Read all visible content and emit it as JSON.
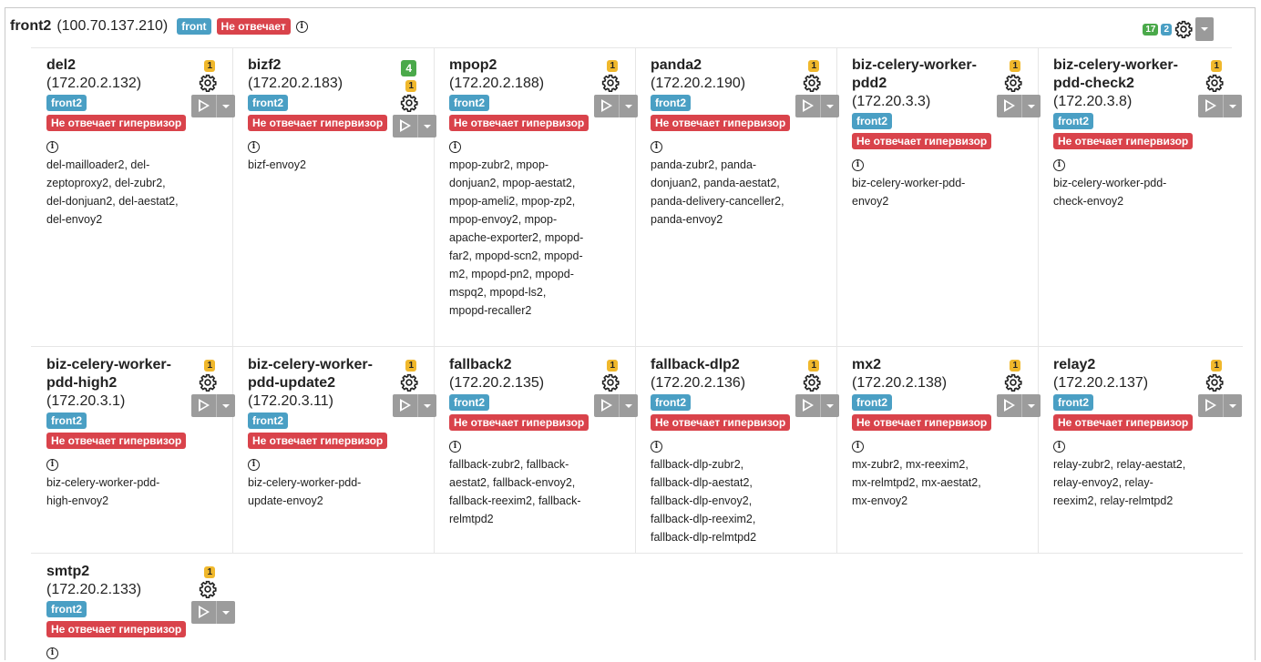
{
  "host": {
    "name": "front2",
    "ip": "(100.70.137.210)",
    "group_label": "front",
    "status_label": "Не отвечает",
    "count_green": "17",
    "count_blue": "2"
  },
  "vms": [
    {
      "name": "del2",
      "ip": "(172.20.2.132)",
      "tag": "front2",
      "status": "Не отвечает гипервизор",
      "badges": [
        {
          "type": "warning",
          "text": "1"
        }
      ],
      "services": "del-mailloader2, del-zeptoproxy2, del-zubr2, del-donjuan2, del-aestat2, del-envoy2"
    },
    {
      "name": "bizf2",
      "ip": "(172.20.2.183)",
      "tag": "front2",
      "status": "Не отвечает гипервизор",
      "badges": [
        {
          "type": "success",
          "text": "4"
        },
        {
          "type": "warning",
          "text": "1"
        }
      ],
      "services": "bizf-envoy2"
    },
    {
      "name": "mpop2",
      "ip": "(172.20.2.188)",
      "tag": "front2",
      "status": "Не отвечает гипервизор",
      "badges": [
        {
          "type": "warning",
          "text": "1"
        }
      ],
      "services": "mpop-zubr2, mpop-donjuan2, mpop-aestat2, mpop-ameli2, mpop-zp2, mpop-envoy2, mpop-apache-exporter2, mpopd-far2, mpopd-scn2, mpopd-m2, mpopd-pn2, mpopd-mspq2, mpopd-ls2, mpopd-recaller2"
    },
    {
      "name": "panda2",
      "ip": "(172.20.2.190)",
      "tag": "front2",
      "status": "Не отвечает гипервизор",
      "badges": [
        {
          "type": "warning",
          "text": "1"
        }
      ],
      "services": "panda-zubr2, panda-donjuan2, panda-aestat2, panda-delivery-canceller2, panda-envoy2"
    },
    {
      "name": "biz-celery-worker-pdd2",
      "ip": "(172.20.3.3)",
      "tag": "front2",
      "status": "Не отвечает гипервизор",
      "badges": [
        {
          "type": "warning",
          "text": "1"
        }
      ],
      "services": "biz-celery-worker-pdd-envoy2"
    },
    {
      "name": "biz-celery-worker-pdd-check2",
      "ip": "(172.20.3.8)",
      "tag": "front2",
      "status": "Не отвечает гипервизор",
      "badges": [
        {
          "type": "warning",
          "text": "1"
        }
      ],
      "services": "biz-celery-worker-pdd-check-envoy2"
    },
    {
      "name": "biz-celery-worker-pdd-high2",
      "ip": "(172.20.3.1)",
      "tag": "front2",
      "status": "Не отвечает гипервизор",
      "badges": [
        {
          "type": "warning",
          "text": "1"
        }
      ],
      "services": "biz-celery-worker-pdd-high-envoy2"
    },
    {
      "name": "biz-celery-worker-pdd-update2",
      "ip": "(172.20.3.11)",
      "tag": "front2",
      "status": "Не отвечает гипервизор",
      "badges": [
        {
          "type": "warning",
          "text": "1"
        }
      ],
      "services": "biz-celery-worker-pdd-update-envoy2"
    },
    {
      "name": "fallback2",
      "ip": "(172.20.2.135)",
      "tag": "front2",
      "status": "Не отвечает гипервизор",
      "badges": [
        {
          "type": "warning",
          "text": "1"
        }
      ],
      "services": "fallback-zubr2, fallback-aestat2, fallback-envoy2, fallback-reexim2, fallback-relmtpd2"
    },
    {
      "name": "fallback-dlp2",
      "ip": "(172.20.2.136)",
      "tag": "front2",
      "status": "Не отвечает гипервизор",
      "badges": [
        {
          "type": "warning",
          "text": "1"
        }
      ],
      "services": "fallback-dlp-zubr2, fallback-dlp-aestat2, fallback-dlp-envoy2, fallback-dlp-reexim2, fallback-dlp-relmtpd2"
    },
    {
      "name": "mx2",
      "ip": "(172.20.2.138)",
      "tag": "front2",
      "status": "Не отвечает гипервизор",
      "badges": [
        {
          "type": "warning",
          "text": "1"
        }
      ],
      "services": "mx-zubr2, mx-reexim2, mx-relmtpd2, mx-aestat2, mx-envoy2"
    },
    {
      "name": "relay2",
      "ip": "(172.20.2.137)",
      "tag": "front2",
      "status": "Не отвечает гипервизор",
      "badges": [
        {
          "type": "warning",
          "text": "1"
        }
      ],
      "services": "relay-zubr2, relay-aestat2, relay-envoy2, relay-reexim2, relay-relmtpd2"
    },
    {
      "name": "smtp2",
      "ip": "(172.20.2.133)",
      "tag": "front2",
      "status": "Не отвечает гипервизор",
      "badges": [
        {
          "type": "warning",
          "text": "1"
        }
      ],
      "services": ""
    }
  ]
}
